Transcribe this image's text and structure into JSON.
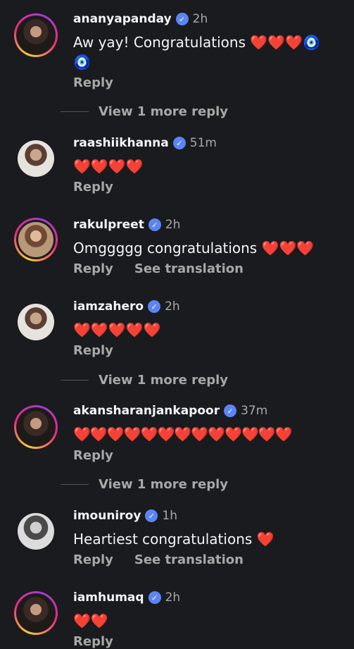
{
  "comments": [
    {
      "username": "ananyapanday",
      "time": "2h",
      "text": "Aw yay! Congratulations ❤️❤️❤️🧿 🧿",
      "reply": "Reply",
      "more": "View 1 more reply"
    },
    {
      "username": "raashiikhanna",
      "time": "51m",
      "text": "❤️❤️❤️❤️",
      "reply": "Reply"
    },
    {
      "username": "rakulpreet",
      "time": "2h",
      "text": "Omggggg congratulations ❤️❤️❤️",
      "reply": "Reply",
      "translation": "See translation"
    },
    {
      "username": "iamzahero",
      "time": "2h",
      "text": "❤️❤️❤️❤️❤️",
      "reply": "Reply",
      "more": "View 1 more reply"
    },
    {
      "username": "akansharanjankapoor",
      "time": "37m",
      "text": "❤️❤️❤️❤️❤️❤️❤️❤️❤️❤️❤️❤️❤️",
      "reply": "Reply",
      "more": "View 1 more reply"
    },
    {
      "username": "imouniroy",
      "time": "1h",
      "text": "Heartiest congratulations ❤️",
      "reply": "Reply",
      "translation": "See translation"
    },
    {
      "username": "iamhumaq",
      "time": "2h",
      "text": "❤️❤️",
      "reply": "Reply"
    }
  ],
  "icons": {
    "verified": "verified-badge-icon"
  },
  "colors": {
    "background": "#1a1b1e",
    "verified": "#5b84f7",
    "muted": "#a8a8a8",
    "text": "#f3f5f7"
  }
}
